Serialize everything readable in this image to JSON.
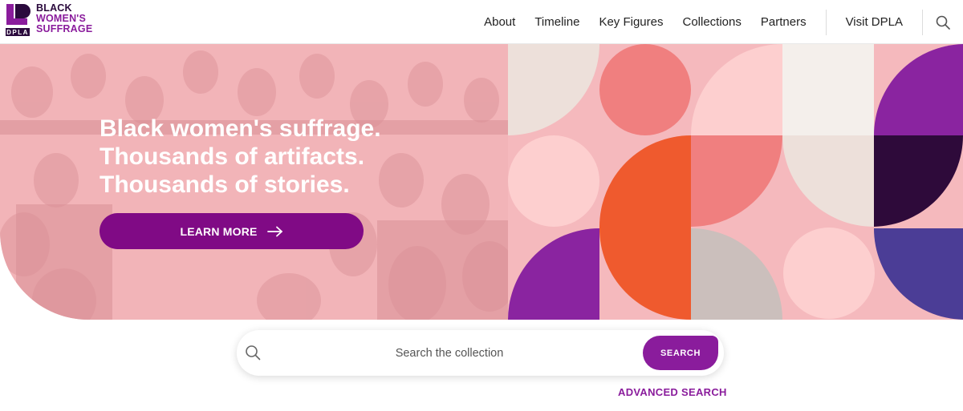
{
  "header": {
    "logo": {
      "line1": "BLACK",
      "line2": "WOMEN'S",
      "line3": "SUFFRAGE",
      "badge": "DPLA",
      "icon": "bws-logo-mark"
    },
    "nav": [
      {
        "label": "About"
      },
      {
        "label": "Timeline"
      },
      {
        "label": "Key Figures"
      },
      {
        "label": "Collections"
      },
      {
        "label": "Partners"
      }
    ],
    "visit_label": "Visit DPLA",
    "search_icon": "search-icon"
  },
  "hero": {
    "headline": [
      "Black women's suffrage.",
      "Thousands of artifacts.",
      "Thousands of stories."
    ],
    "cta_label": "LEARN MORE",
    "cta_icon": "arrow-right-icon",
    "photo_tint": "#f2b4b8"
  },
  "search": {
    "placeholder": "Search the collection",
    "button_label": "SEARCH",
    "advanced_label": "ADVANCED SEARCH"
  },
  "colors": {
    "brand_purple": "#8a1c9c",
    "cta_purple": "#800a85",
    "coral": "#f07f7f",
    "orange": "#ef5a2e",
    "deep_plum": "#2e0a3a",
    "indigo": "#4b3d96",
    "pale_pink": "#fdcfcf",
    "cream": "#f4efeb",
    "taupe": "#cbbfbc"
  }
}
